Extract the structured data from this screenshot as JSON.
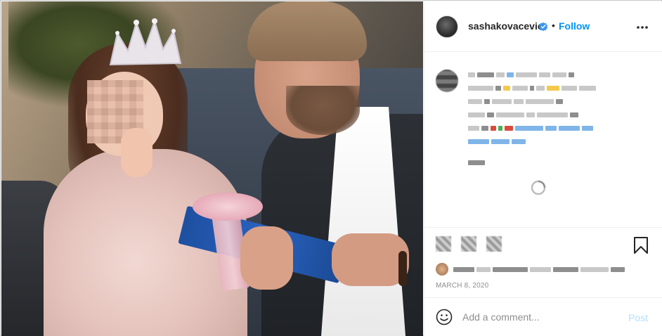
{
  "post": {
    "photo_alt": "Man with a gift and girl in a pink dress on a sofa"
  },
  "header": {
    "username": "sashakovacevic",
    "separator": "•",
    "follow_label": "Follow",
    "verified_icon": "verified-badge-icon",
    "more_icon": "more-options-icon"
  },
  "comments": {
    "obscured": true,
    "loader_icon": "load-more-icon"
  },
  "actions": {
    "obscured_icons": [
      "like-icon",
      "comment-icon",
      "share-icon"
    ],
    "bookmark_icon": "bookmark-icon",
    "date": "MARCH 8, 2020"
  },
  "comment_bar": {
    "emoji_icon": "emoji-icon",
    "placeholder": "Add a comment...",
    "post_label": "Post"
  },
  "colors": {
    "accent": "#0095f6",
    "post_disabled": "#b2dffc",
    "text": "#262626",
    "muted": "#8e8e8e",
    "border": "#efefef"
  }
}
